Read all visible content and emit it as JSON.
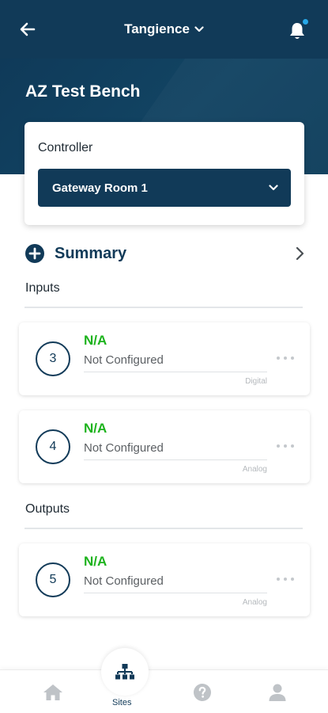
{
  "header": {
    "title": "Tangience",
    "back_icon": "arrow-left-icon",
    "bell_icon": "bell-icon",
    "has_notification": true
  },
  "site": {
    "title": "AZ Test Bench"
  },
  "controller": {
    "label": "Controller",
    "selected": "Gateway Room 1"
  },
  "summary": {
    "label": "Summary"
  },
  "inputs": {
    "title": "Inputs",
    "items": [
      {
        "number": "3",
        "status": "N/A",
        "config": "Not Configured",
        "type": "Digital"
      },
      {
        "number": "4",
        "status": "N/A",
        "config": "Not Configured",
        "type": "Analog"
      }
    ]
  },
  "outputs": {
    "title": "Outputs",
    "items": [
      {
        "number": "5",
        "status": "N/A",
        "config": "Not Configured",
        "type": "Analog"
      }
    ]
  },
  "bottom_nav": {
    "items": [
      {
        "icon": "home-icon"
      },
      {
        "icon": "sites-icon",
        "label": "Sites",
        "active": true
      },
      {
        "icon": "help-icon"
      },
      {
        "icon": "profile-icon"
      }
    ]
  },
  "colors": {
    "primary": "#113a58",
    "status_green": "#1db31d",
    "notification": "#27a8e8"
  }
}
